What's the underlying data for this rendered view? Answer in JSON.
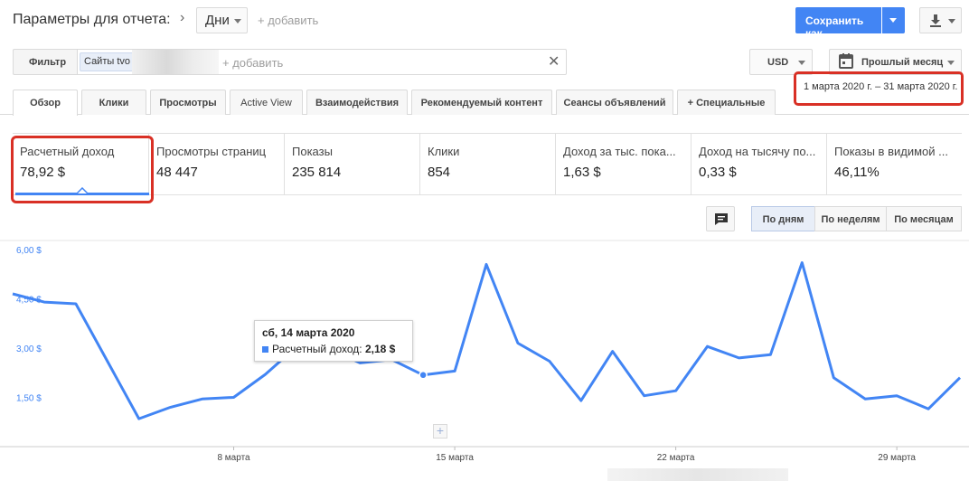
{
  "header": {
    "title": "Параметры для отчета:",
    "dimension": "Дни",
    "add_link": "+ добавить",
    "save_label": "Сохранить как"
  },
  "filter": {
    "label": "Фильтр",
    "chip": "Сайты tvo",
    "add_placeholder": "+ добавить",
    "clear": "✕"
  },
  "currency": "USD",
  "period": {
    "label": "Прошлый месяц",
    "range": "1 марта 2020 г. – 31 марта 2020 г."
  },
  "tabs": [
    {
      "label": "Обзор"
    },
    {
      "label": "Клики"
    },
    {
      "label": "Просмотры"
    },
    {
      "label": "Active View"
    },
    {
      "label": "Взаимодействия"
    },
    {
      "label": "Рекомендуемый контент"
    },
    {
      "label": "Сеансы объявлений"
    },
    {
      "label": "+  Специальные"
    }
  ],
  "metrics": [
    {
      "label": "Расчетный доход",
      "value": "78,92 $"
    },
    {
      "label": "Просмотры страниц",
      "value": "48 447"
    },
    {
      "label": "Показы",
      "value": "235 814"
    },
    {
      "label": "Клики",
      "value": "854"
    },
    {
      "label": "Доход за тыс. пока...",
      "value": "1,63 $"
    },
    {
      "label": "Доход на тысячу по...",
      "value": "0,33 $"
    },
    {
      "label": "Показы в видимой ...",
      "value": "46,11%"
    }
  ],
  "granularity": [
    {
      "label": "По дням"
    },
    {
      "label": "По неделям"
    },
    {
      "label": "По месяцам"
    }
  ],
  "tooltip": {
    "date": "сб, 14 марта 2020",
    "metric": "Расчетный доход:",
    "value": "2,18 $"
  },
  "colors": {
    "accent": "#4285f4",
    "highlight": "#d93025"
  },
  "chart_data": {
    "type": "line",
    "series": [
      {
        "name": "Расчетный доход",
        "x": [
          "2020-03-01",
          "2020-03-02",
          "2020-03-03",
          "2020-03-04",
          "2020-03-05",
          "2020-03-06",
          "2020-03-07",
          "2020-03-08",
          "2020-03-09",
          "2020-03-10",
          "2020-03-11",
          "2020-03-12",
          "2020-03-13",
          "2020-03-14",
          "2020-03-15",
          "2020-03-16",
          "2020-03-17",
          "2020-03-18",
          "2020-03-19",
          "2020-03-20",
          "2020-03-21",
          "2020-03-22",
          "2020-03-23",
          "2020-03-24",
          "2020-03-25",
          "2020-03-26",
          "2020-03-27",
          "2020-03-28",
          "2020-03-29",
          "2020-03-30",
          "2020-03-31"
        ],
        "values": [
          4.65,
          4.4,
          4.35,
          2.6,
          0.85,
          1.2,
          1.45,
          1.5,
          2.2,
          3.05,
          3.0,
          2.55,
          2.65,
          2.18,
          2.3,
          5.55,
          3.15,
          2.6,
          1.4,
          2.9,
          1.55,
          1.7,
          3.05,
          2.7,
          2.8,
          5.6,
          2.1,
          1.45,
          1.55,
          1.15,
          2.1
        ]
      }
    ],
    "x_tick_labels": [
      "8 марта",
      "15 марта",
      "22 марта",
      "29 марта"
    ],
    "x_tick_dates": [
      "2020-03-08",
      "2020-03-15",
      "2020-03-22",
      "2020-03-29"
    ],
    "y_tick_labels": [
      "6,00 $",
      "4,50 $",
      "3,00 $",
      "1,50 $"
    ],
    "y_ticks": [
      6.0,
      4.5,
      3.0,
      1.5
    ],
    "ylim": [
      0,
      6.0
    ],
    "grid": false,
    "highlighted_date": "2020-03-14"
  }
}
